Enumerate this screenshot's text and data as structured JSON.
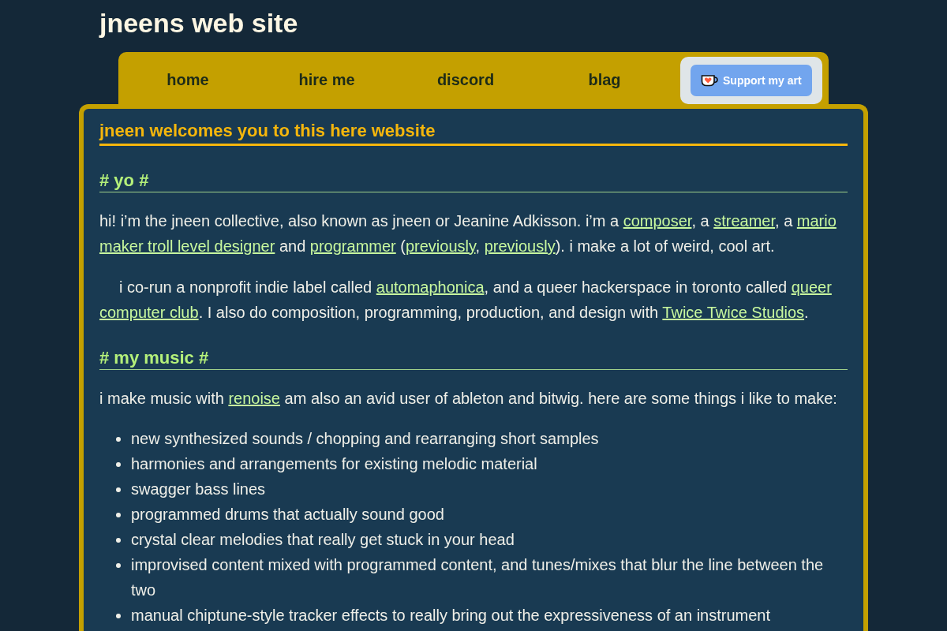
{
  "site_title": "jneens web site",
  "nav": {
    "items": [
      {
        "label": "home"
      },
      {
        "label": "hire me"
      },
      {
        "label": "discord"
      },
      {
        "label": "blag"
      }
    ],
    "support_button": {
      "label": "Support my art"
    }
  },
  "main": {
    "heading": "jneen welcomes you to this here website",
    "sections": [
      {
        "heading": "# yo #",
        "blocks": [
          {
            "kind": "paragraph",
            "indented": false,
            "segments": [
              {
                "kind": "text",
                "text": "hi! i’m the jneen collective, also known as jneen or Jeanine Adkisson. i’m a "
              },
              {
                "kind": "link",
                "lines": [
                  "composer"
                ]
              },
              {
                "kind": "text",
                "text": ", a "
              },
              {
                "kind": "link",
                "lines": [
                  "streamer"
                ]
              },
              {
                "kind": "text",
                "text": ", a "
              },
              {
                "kind": "link",
                "lines": [
                  "mario",
                  "maker troll level designer"
                ]
              },
              {
                "kind": "text",
                "text": " and "
              },
              {
                "kind": "link",
                "lines": [
                  "programmer"
                ]
              },
              {
                "kind": "text",
                "text": " ("
              },
              {
                "kind": "link",
                "lines": [
                  "previously"
                ]
              },
              {
                "kind": "text",
                "text": ", "
              },
              {
                "kind": "link",
                "lines": [
                  "previously"
                ]
              },
              {
                "kind": "text",
                "text": "). i make a lot of weird, cool art."
              }
            ]
          },
          {
            "kind": "paragraph",
            "indented": true,
            "segments": [
              {
                "kind": "text",
                "text": "i co-run a nonprofit indie label called "
              },
              {
                "kind": "link",
                "lines": [
                  "automaphonica"
                ]
              },
              {
                "kind": "text",
                "text": ", and a queer hackerspace in toronto called "
              },
              {
                "kind": "link",
                "lines": [
                  "queer",
                  "computer club"
                ]
              },
              {
                "kind": "text",
                "text": ". I also do composition, programming, production, and design with "
              },
              {
                "kind": "link",
                "lines": [
                  "Twice Twice Studios"
                ]
              },
              {
                "kind": "text",
                "text": "."
              }
            ]
          }
        ]
      },
      {
        "heading": "# my music #",
        "blocks": [
          {
            "kind": "paragraph",
            "indented": false,
            "segments": [
              {
                "kind": "text",
                "text": "i make music with "
              },
              {
                "kind": "link",
                "lines": [
                  "renoise"
                ]
              },
              {
                "kind": "text",
                "text": " am also an avid user of ableton and bitwig. here are some things i like to make:"
              }
            ]
          },
          {
            "kind": "list",
            "items": [
              "new synthesized sounds / chopping and rearranging short samples",
              "harmonies and arrangements for existing melodic material",
              "swagger bass lines",
              "programmed drums that actually sound good",
              "crystal clear melodies that really get stuck in your head",
              "improvised content mixed with programmed content, and tunes/mixes that blur the line between the two",
              "manual chiptune-style tracker effects to really bring out the expressiveness of an instrument"
            ]
          }
        ]
      }
    ]
  }
}
